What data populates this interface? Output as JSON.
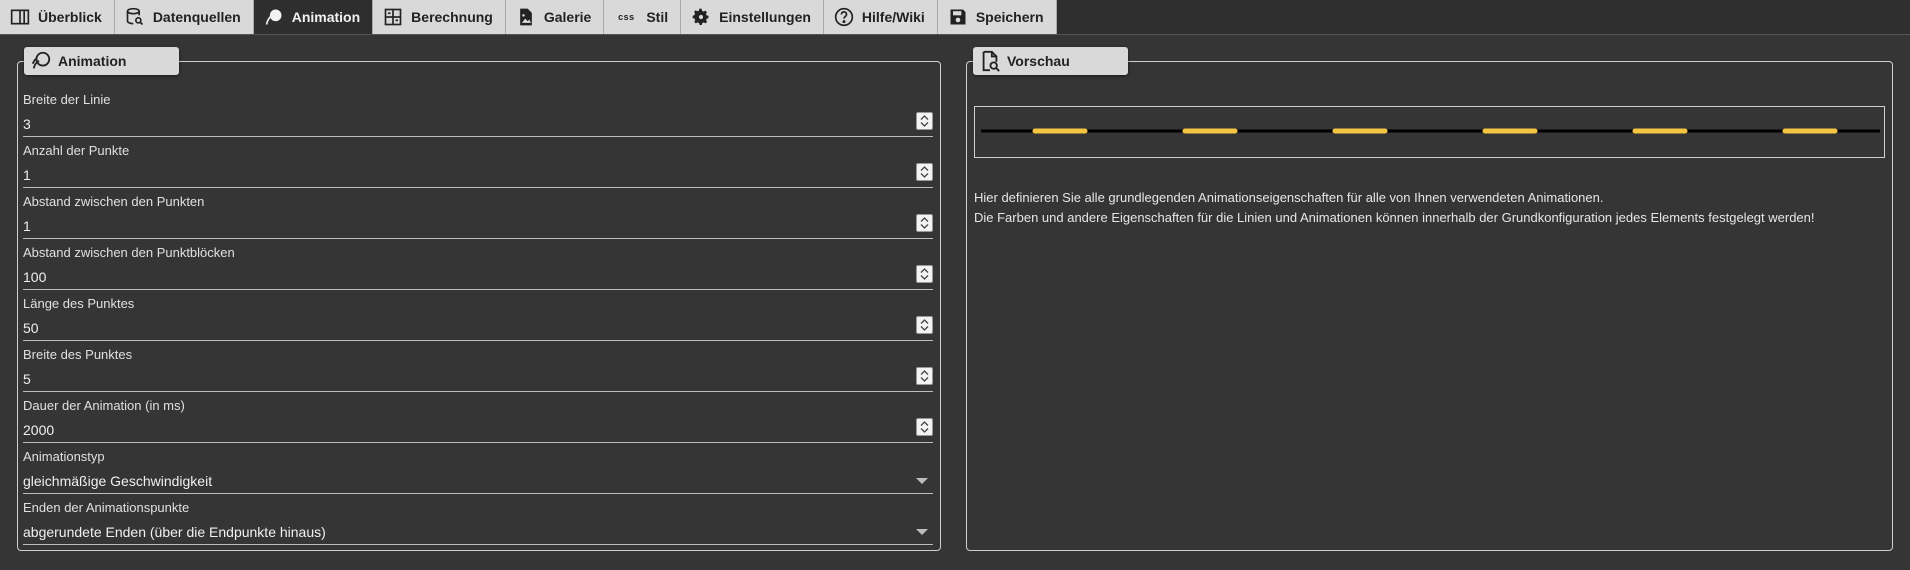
{
  "tabs": [
    {
      "label": "Überblick",
      "icon": "columns-icon"
    },
    {
      "label": "Datenquellen",
      "icon": "database-search-icon"
    },
    {
      "label": "Animation",
      "icon": "animation-icon"
    },
    {
      "label": "Berechnung",
      "icon": "calculator-icon"
    },
    {
      "label": "Galerie",
      "icon": "image-file-icon"
    },
    {
      "label": "Stil",
      "icon": "css-icon",
      "glyph": "css"
    },
    {
      "label": "Einstellungen",
      "icon": "gear-icon"
    },
    {
      "label": "Hilfe/Wiki",
      "icon": "help-icon"
    },
    {
      "label": "Speichern",
      "icon": "save-icon"
    }
  ],
  "active_tab": "Animation",
  "animation_panel": {
    "title": "Animation",
    "fields": [
      {
        "label": "Breite der Linie",
        "value": "3",
        "kind": "number"
      },
      {
        "label": "Anzahl der Punkte",
        "value": "1",
        "kind": "number"
      },
      {
        "label": "Abstand zwischen den Punkten",
        "value": "1",
        "kind": "number"
      },
      {
        "label": "Abstand zwischen den Punktblöcken",
        "value": "100",
        "kind": "number"
      },
      {
        "label": "Länge des Punktes",
        "value": "50",
        "kind": "number"
      },
      {
        "label": "Breite des Punktes",
        "value": "5",
        "kind": "number"
      },
      {
        "label": "Dauer der Animation (in ms)",
        "value": "2000",
        "kind": "number"
      },
      {
        "label": "Animationstyp",
        "value": "gleichmäßige Geschwindigkeit",
        "kind": "select"
      },
      {
        "label": "Enden der Animationspunkte",
        "value": "abgerundete Enden (über die Endpunkte hinaus)",
        "kind": "select"
      }
    ]
  },
  "preview_panel": {
    "title": "Vorschau",
    "info_line1": "Hier definieren Sie alle grundlegenden Animationseigenschaften für alle von Ihnen verwendeten Animationen.",
    "info_line2": "Die Farben und andere Eigenschaften für die Linien und Animationen können innerhalb der Grundkonfiguration jedes Elements festgelegt werden!"
  },
  "colors": {
    "background": "#353535",
    "line": "#000000",
    "dot": "#f5c542"
  }
}
